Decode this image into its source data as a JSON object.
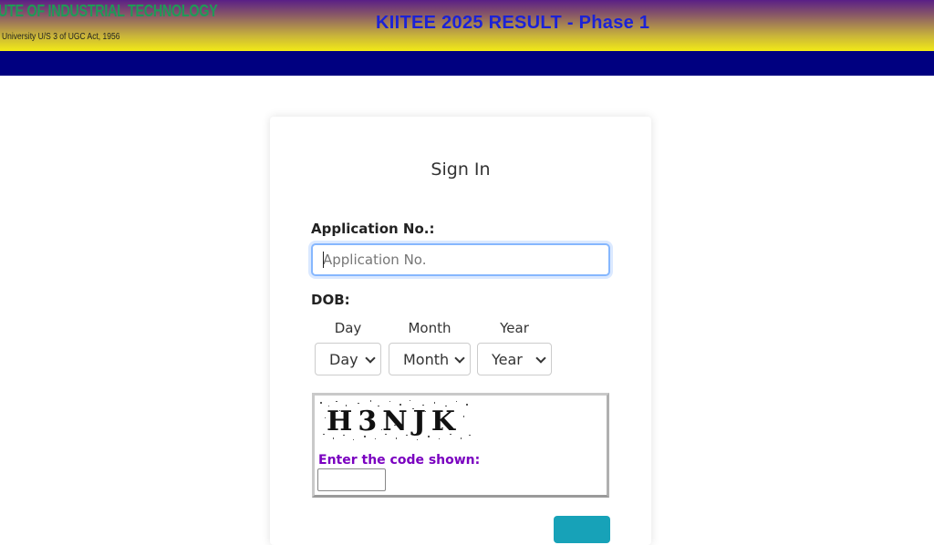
{
  "header": {
    "logo_text": "UTE OF INDUSTRIAL TECHNOLOGY",
    "logo_subtext": "University U/S 3 of UGC Act, 1956",
    "title": "KIITEE 2025 RESULT - Phase 1",
    "colors": {
      "title": "#1c22d6",
      "navbar": "#000080",
      "logo": "#1f9a57"
    }
  },
  "form": {
    "heading": "Sign In",
    "application_label": "Application No.:",
    "application_placeholder": "Application No.",
    "dob_label": "DOB:",
    "day_label": "Day",
    "month_label": "Month",
    "year_label": "Year",
    "day_selected": "Day",
    "month_selected": "Month",
    "year_selected": "Year",
    "captcha_text": "H3NJK",
    "captcha_prompt": "Enter the code shown:",
    "captcha_value": "",
    "submit_color": "#17a2b8"
  }
}
